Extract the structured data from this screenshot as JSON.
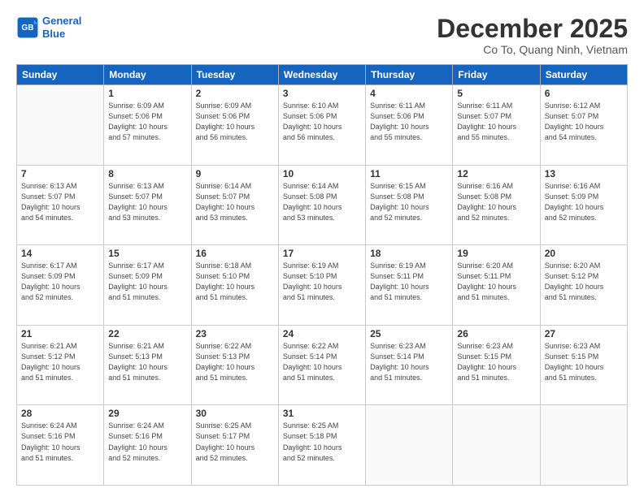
{
  "header": {
    "logo_line1": "General",
    "logo_line2": "Blue",
    "month": "December 2025",
    "location": "Co To, Quang Ninh, Vietnam"
  },
  "weekdays": [
    "Sunday",
    "Monday",
    "Tuesday",
    "Wednesday",
    "Thursday",
    "Friday",
    "Saturday"
  ],
  "weeks": [
    [
      {
        "day": "",
        "info": ""
      },
      {
        "day": "1",
        "info": "Sunrise: 6:09 AM\nSunset: 5:06 PM\nDaylight: 10 hours\nand 57 minutes."
      },
      {
        "day": "2",
        "info": "Sunrise: 6:09 AM\nSunset: 5:06 PM\nDaylight: 10 hours\nand 56 minutes."
      },
      {
        "day": "3",
        "info": "Sunrise: 6:10 AM\nSunset: 5:06 PM\nDaylight: 10 hours\nand 56 minutes."
      },
      {
        "day": "4",
        "info": "Sunrise: 6:11 AM\nSunset: 5:06 PM\nDaylight: 10 hours\nand 55 minutes."
      },
      {
        "day": "5",
        "info": "Sunrise: 6:11 AM\nSunset: 5:07 PM\nDaylight: 10 hours\nand 55 minutes."
      },
      {
        "day": "6",
        "info": "Sunrise: 6:12 AM\nSunset: 5:07 PM\nDaylight: 10 hours\nand 54 minutes."
      }
    ],
    [
      {
        "day": "7",
        "info": "Sunrise: 6:13 AM\nSunset: 5:07 PM\nDaylight: 10 hours\nand 54 minutes."
      },
      {
        "day": "8",
        "info": "Sunrise: 6:13 AM\nSunset: 5:07 PM\nDaylight: 10 hours\nand 53 minutes."
      },
      {
        "day": "9",
        "info": "Sunrise: 6:14 AM\nSunset: 5:07 PM\nDaylight: 10 hours\nand 53 minutes."
      },
      {
        "day": "10",
        "info": "Sunrise: 6:14 AM\nSunset: 5:08 PM\nDaylight: 10 hours\nand 53 minutes."
      },
      {
        "day": "11",
        "info": "Sunrise: 6:15 AM\nSunset: 5:08 PM\nDaylight: 10 hours\nand 52 minutes."
      },
      {
        "day": "12",
        "info": "Sunrise: 6:16 AM\nSunset: 5:08 PM\nDaylight: 10 hours\nand 52 minutes."
      },
      {
        "day": "13",
        "info": "Sunrise: 6:16 AM\nSunset: 5:09 PM\nDaylight: 10 hours\nand 52 minutes."
      }
    ],
    [
      {
        "day": "14",
        "info": "Sunrise: 6:17 AM\nSunset: 5:09 PM\nDaylight: 10 hours\nand 52 minutes."
      },
      {
        "day": "15",
        "info": "Sunrise: 6:17 AM\nSunset: 5:09 PM\nDaylight: 10 hours\nand 51 minutes."
      },
      {
        "day": "16",
        "info": "Sunrise: 6:18 AM\nSunset: 5:10 PM\nDaylight: 10 hours\nand 51 minutes."
      },
      {
        "day": "17",
        "info": "Sunrise: 6:19 AM\nSunset: 5:10 PM\nDaylight: 10 hours\nand 51 minutes."
      },
      {
        "day": "18",
        "info": "Sunrise: 6:19 AM\nSunset: 5:11 PM\nDaylight: 10 hours\nand 51 minutes."
      },
      {
        "day": "19",
        "info": "Sunrise: 6:20 AM\nSunset: 5:11 PM\nDaylight: 10 hours\nand 51 minutes."
      },
      {
        "day": "20",
        "info": "Sunrise: 6:20 AM\nSunset: 5:12 PM\nDaylight: 10 hours\nand 51 minutes."
      }
    ],
    [
      {
        "day": "21",
        "info": "Sunrise: 6:21 AM\nSunset: 5:12 PM\nDaylight: 10 hours\nand 51 minutes."
      },
      {
        "day": "22",
        "info": "Sunrise: 6:21 AM\nSunset: 5:13 PM\nDaylight: 10 hours\nand 51 minutes."
      },
      {
        "day": "23",
        "info": "Sunrise: 6:22 AM\nSunset: 5:13 PM\nDaylight: 10 hours\nand 51 minutes."
      },
      {
        "day": "24",
        "info": "Sunrise: 6:22 AM\nSunset: 5:14 PM\nDaylight: 10 hours\nand 51 minutes."
      },
      {
        "day": "25",
        "info": "Sunrise: 6:23 AM\nSunset: 5:14 PM\nDaylight: 10 hours\nand 51 minutes."
      },
      {
        "day": "26",
        "info": "Sunrise: 6:23 AM\nSunset: 5:15 PM\nDaylight: 10 hours\nand 51 minutes."
      },
      {
        "day": "27",
        "info": "Sunrise: 6:23 AM\nSunset: 5:15 PM\nDaylight: 10 hours\nand 51 minutes."
      }
    ],
    [
      {
        "day": "28",
        "info": "Sunrise: 6:24 AM\nSunset: 5:16 PM\nDaylight: 10 hours\nand 51 minutes."
      },
      {
        "day": "29",
        "info": "Sunrise: 6:24 AM\nSunset: 5:16 PM\nDaylight: 10 hours\nand 52 minutes."
      },
      {
        "day": "30",
        "info": "Sunrise: 6:25 AM\nSunset: 5:17 PM\nDaylight: 10 hours\nand 52 minutes."
      },
      {
        "day": "31",
        "info": "Sunrise: 6:25 AM\nSunset: 5:18 PM\nDaylight: 10 hours\nand 52 minutes."
      },
      {
        "day": "",
        "info": ""
      },
      {
        "day": "",
        "info": ""
      },
      {
        "day": "",
        "info": ""
      }
    ]
  ]
}
